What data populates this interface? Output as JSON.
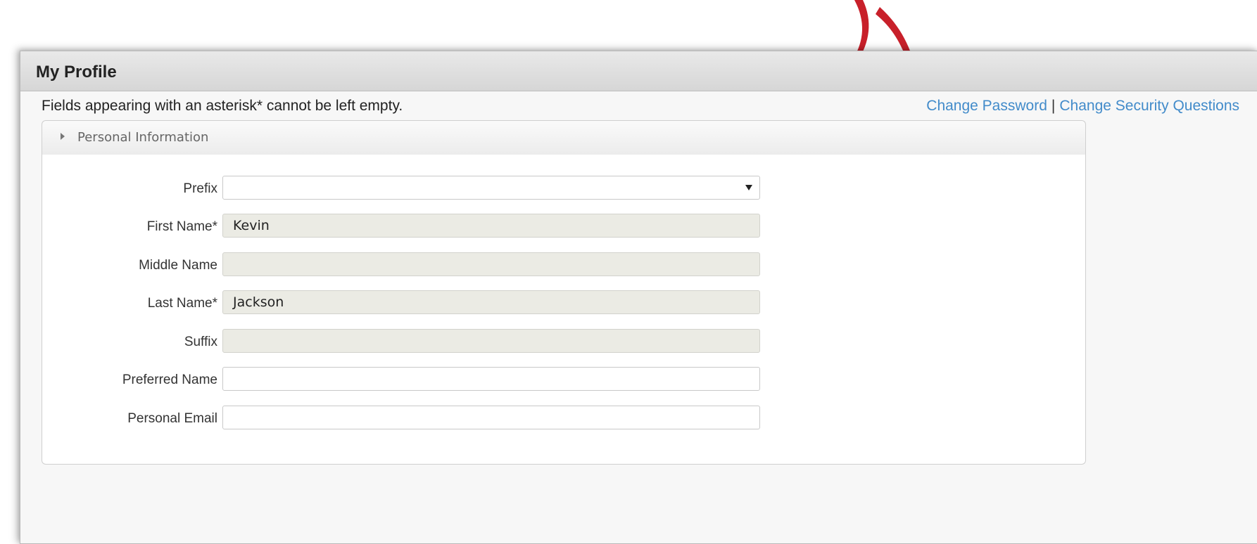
{
  "panel": {
    "title": "My Profile",
    "note": "Fields appearing with an asterisk* cannot be left empty."
  },
  "links": {
    "change_password": "Change Password",
    "separator": "|",
    "change_security": "Change Security Questions",
    "color": "#428bca"
  },
  "section": {
    "title": "Personal Information",
    "icon": "caret-right-icon"
  },
  "fields": {
    "prefix": {
      "label": "Prefix",
      "value": ""
    },
    "first_name": {
      "label": "First Name*",
      "value": "Kevin"
    },
    "middle_name": {
      "label": "Middle Name",
      "value": ""
    },
    "last_name": {
      "label": "Last Name*",
      "value": "Jackson"
    },
    "suffix": {
      "label": "Suffix",
      "value": ""
    },
    "preferred_name": {
      "label": "Preferred Name",
      "value": ""
    },
    "personal_email": {
      "label": "Personal Email",
      "value": ""
    }
  },
  "annotation_color": "#c8202a"
}
